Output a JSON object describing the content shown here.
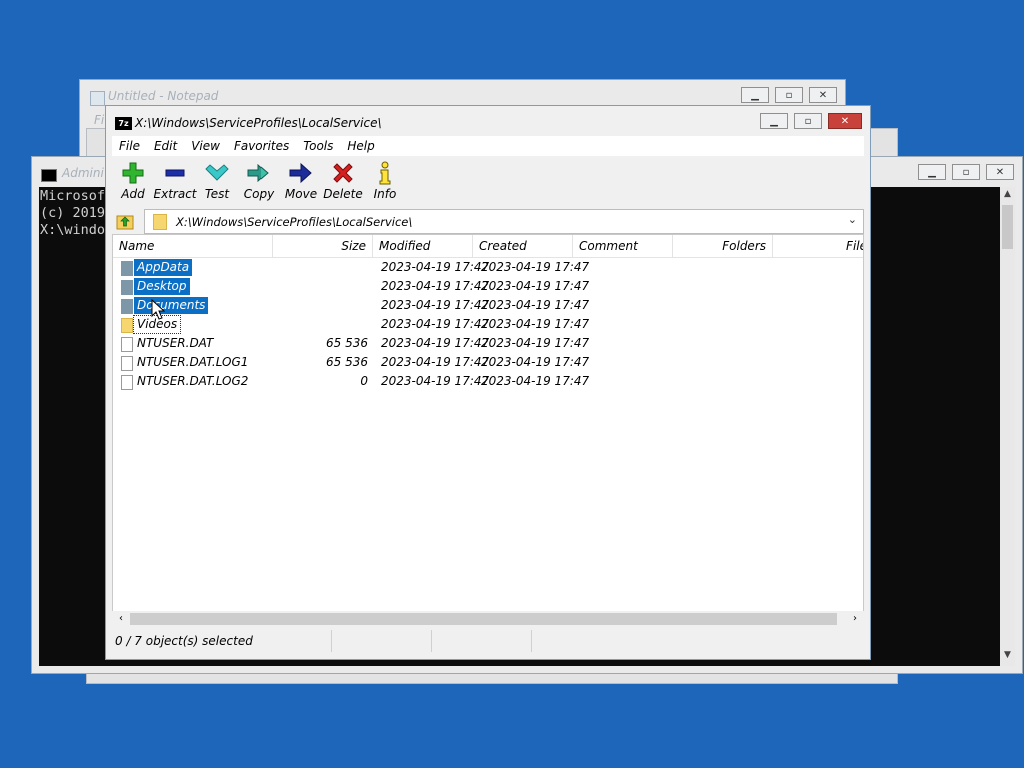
{
  "notepad": {
    "title": "Untitled - Notepad",
    "menu_first": "Fi"
  },
  "console": {
    "title": "Admini",
    "lines": [
      "Microsof",
      "(c) 2019",
      "",
      "X:\\windo"
    ]
  },
  "zip": {
    "title": "X:\\Windows\\ServiceProfiles\\LocalService\\",
    "menu": [
      "File",
      "Edit",
      "View",
      "Favorites",
      "Tools",
      "Help"
    ],
    "toolbar": [
      {
        "label": "Add",
        "icon": "plus-icon"
      },
      {
        "label": "Extract",
        "icon": "minus-icon"
      },
      {
        "label": "Test",
        "icon": "check-icon"
      },
      {
        "label": "Copy",
        "icon": "double-arrow-icon"
      },
      {
        "label": "Move",
        "icon": "arrow-right-icon"
      },
      {
        "label": "Delete",
        "icon": "x-icon"
      },
      {
        "label": "Info",
        "icon": "info-icon"
      }
    ],
    "address": "X:\\Windows\\ServiceProfiles\\LocalService\\",
    "columns": [
      "Name",
      "Size",
      "Modified",
      "Created",
      "Comment",
      "Folders",
      "File"
    ],
    "rows": [
      {
        "name": "AppData",
        "size": "",
        "modified": "2023-04-19 17:47",
        "created": "2023-04-19 17:47",
        "type": "folder",
        "selected": true
      },
      {
        "name": "Desktop",
        "size": "",
        "modified": "2023-04-19 17:47",
        "created": "2023-04-19 17:47",
        "type": "folder",
        "selected": true
      },
      {
        "name": "Documents",
        "size": "",
        "modified": "2023-04-19 17:47",
        "created": "2023-04-19 17:47",
        "type": "folder",
        "selected": true
      },
      {
        "name": "Videos",
        "size": "",
        "modified": "2023-04-19 17:47",
        "created": "2023-04-19 17:47",
        "type": "folder",
        "selected": false
      },
      {
        "name": "NTUSER.DAT",
        "size": "65 536",
        "modified": "2023-04-19 17:47",
        "created": "2023-04-19 17:47",
        "type": "file",
        "selected": false
      },
      {
        "name": "NTUSER.DAT.LOG1",
        "size": "65 536",
        "modified": "2023-04-19 17:47",
        "created": "2023-04-19 17:47",
        "type": "file",
        "selected": false
      },
      {
        "name": "NTUSER.DAT.LOG2",
        "size": "0",
        "modified": "2023-04-19 17:47",
        "created": "2023-04-19 17:47",
        "type": "file",
        "selected": false
      }
    ],
    "status": "0 / 7 object(s) selected"
  },
  "colors": {
    "desktop": "#1e66b9",
    "selection": "#0b6fc6"
  }
}
